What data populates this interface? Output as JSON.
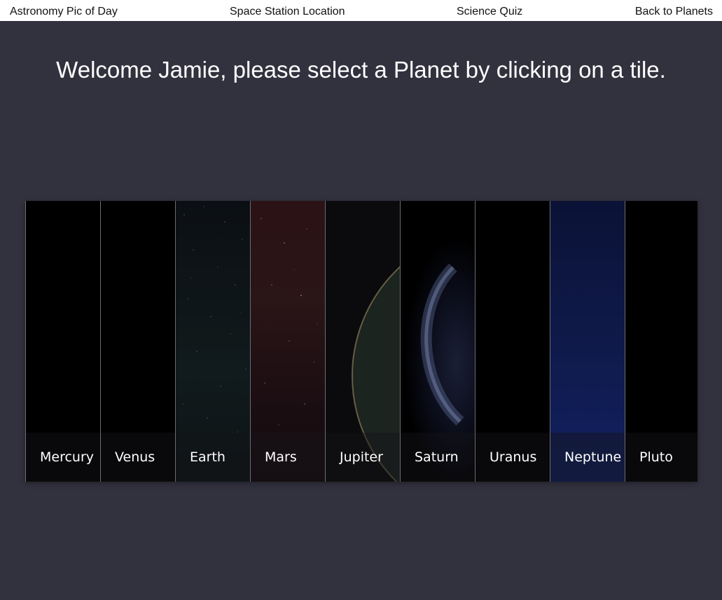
{
  "nav": {
    "apod": "Astronomy Pic of Day",
    "iss": "Space Station Location",
    "quiz": "Science Quiz",
    "back": "Back to Planets"
  },
  "welcome": "Welcome Jamie, please select a Planet by clicking on a tile.",
  "planets": [
    {
      "name": "Mercury"
    },
    {
      "name": "Venus"
    },
    {
      "name": "Earth"
    },
    {
      "name": "Mars"
    },
    {
      "name": "Jupiter"
    },
    {
      "name": "Saturn"
    },
    {
      "name": "Uranus"
    },
    {
      "name": "Neptune"
    },
    {
      "name": "Pluto"
    }
  ],
  "colors": {
    "page_background": "#32313e",
    "nav_background": "#ffffff",
    "text_light": "#ffffff"
  }
}
